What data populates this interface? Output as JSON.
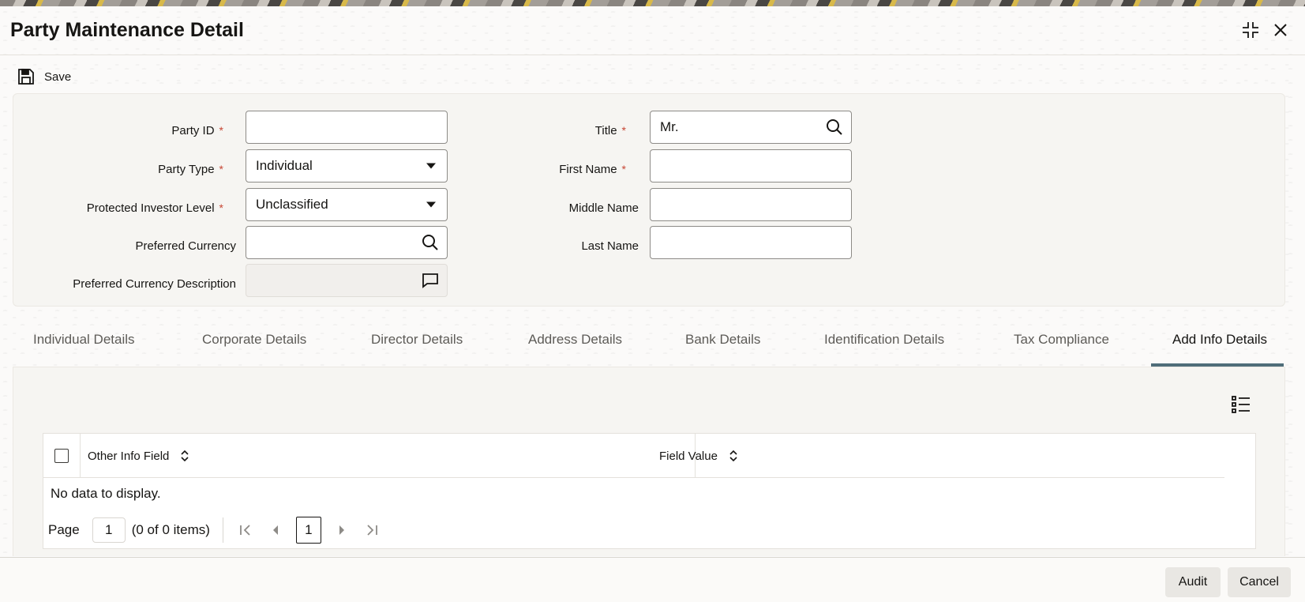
{
  "window": {
    "title": "Party Maintenance Detail"
  },
  "toolbar": {
    "save_label": "Save"
  },
  "form": {
    "party_id": {
      "label": "Party ID",
      "value": ""
    },
    "party_type": {
      "label": "Party Type",
      "value": "Individual"
    },
    "protected_investor_level": {
      "label": "Protected Investor Level",
      "value": "Unclassified"
    },
    "preferred_currency": {
      "label": "Preferred Currency",
      "value": ""
    },
    "preferred_currency_description": {
      "label": "Preferred Currency Description",
      "value": ""
    },
    "title": {
      "label": "Title",
      "value": "Mr."
    },
    "first_name": {
      "label": "First Name",
      "value": ""
    },
    "middle_name": {
      "label": "Middle Name",
      "value": ""
    },
    "last_name": {
      "label": "Last Name",
      "value": ""
    },
    "required_marker": "*"
  },
  "tabs": [
    {
      "label": "Individual Details"
    },
    {
      "label": "Corporate Details"
    },
    {
      "label": "Director Details"
    },
    {
      "label": "Address Details"
    },
    {
      "label": "Bank Details"
    },
    {
      "label": "Identification Details"
    },
    {
      "label": "Tax Compliance"
    },
    {
      "label": "Add Info Details",
      "active": true
    }
  ],
  "grid": {
    "columns": [
      {
        "label": "Other Info Field"
      },
      {
        "label": "Field Value"
      }
    ],
    "empty_text": "No data to display.",
    "pager": {
      "page_label": "Page",
      "page_value": "1",
      "items_text": "(0 of 0 items)",
      "current_page": "1"
    }
  },
  "footer": {
    "audit_label": "Audit",
    "cancel_label": "Cancel"
  },
  "colors": {
    "accent_underline": "#4f6d7a",
    "required": "#c74634"
  }
}
